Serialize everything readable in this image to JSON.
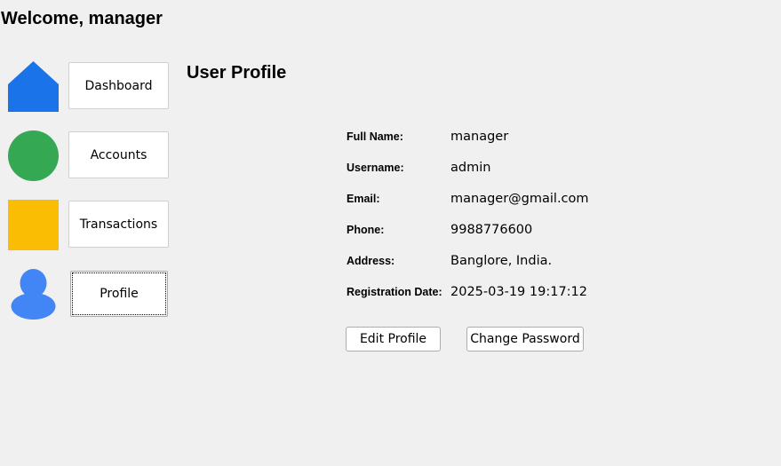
{
  "header": {
    "welcome": "Welcome, manager"
  },
  "nav": {
    "items": [
      {
        "label": "Dashboard",
        "icon": "home-icon",
        "color": "#1a73e8"
      },
      {
        "label": "Accounts",
        "icon": "circle-icon",
        "color": "#34a853"
      },
      {
        "label": "Transactions",
        "icon": "square-icon",
        "color": "#fbbc04"
      },
      {
        "label": "Profile",
        "icon": "user-icon",
        "color": "#4285f4"
      }
    ],
    "active": "Profile"
  },
  "profile": {
    "title": "User Profile",
    "fields": [
      {
        "label": "Full Name:",
        "value": "manager"
      },
      {
        "label": "Username:",
        "value": "admin"
      },
      {
        "label": "Email:",
        "value": "manager@gmail.com"
      },
      {
        "label": "Phone:",
        "value": "9988776600"
      },
      {
        "label": "Address:",
        "value": "Banglore, India."
      },
      {
        "label": "Registration Date:",
        "value": "2025-03-19 19:17:12"
      }
    ],
    "edit_label": "Edit Profile",
    "change_password_label": "Change Password"
  }
}
